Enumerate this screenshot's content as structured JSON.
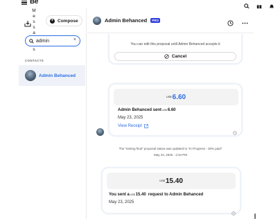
{
  "app": {
    "brand": "Be",
    "top_icons": [
      "search-icon",
      "gift-icon",
      "bell-icon"
    ]
  },
  "sidebar": {
    "vertical_label": [
      "M",
      "e",
      "s",
      "s",
      "a",
      "g",
      "e",
      "s"
    ],
    "compose_label": "Compose",
    "search": {
      "value": "admin",
      "clear": "×"
    },
    "contacts_heading": "CONTACTS",
    "contacts": [
      {
        "name": "Admin Behanced",
        "selected": true
      }
    ]
  },
  "chat": {
    "title": "Admin Behanced",
    "badge": "PRO",
    "edit_note": "You can edit this proposal until Admin Behanced accepts it",
    "cancel_label": "Cancel",
    "messages": [
      {
        "currency": "US$",
        "amount": "6.60",
        "sender_line_prefix": "Admin Behanced sent",
        "sender_currency": "US$",
        "sender_amount": "6.60",
        "date": "May 23, 2025",
        "link": "View Receipt"
      },
      {
        "status": "The \"testing final\" proposal status was updated to \"In Progress - 30% paid\"",
        "timestamp": "May 23, 2025 - 2:34 PM"
      },
      {
        "currency": "US$",
        "amount": "15.40",
        "sender_line_prefix": "You sent a",
        "sender_currency": "US$",
        "sender_amount": "15.40",
        "sender_line_suffix": "request to Admin Behanced",
        "date": "May 23, 2025"
      }
    ]
  },
  "colors": {
    "accent": "#2f6ee4",
    "pro_badge": "#2f3fd9",
    "selected_row": "#eef2f8"
  }
}
